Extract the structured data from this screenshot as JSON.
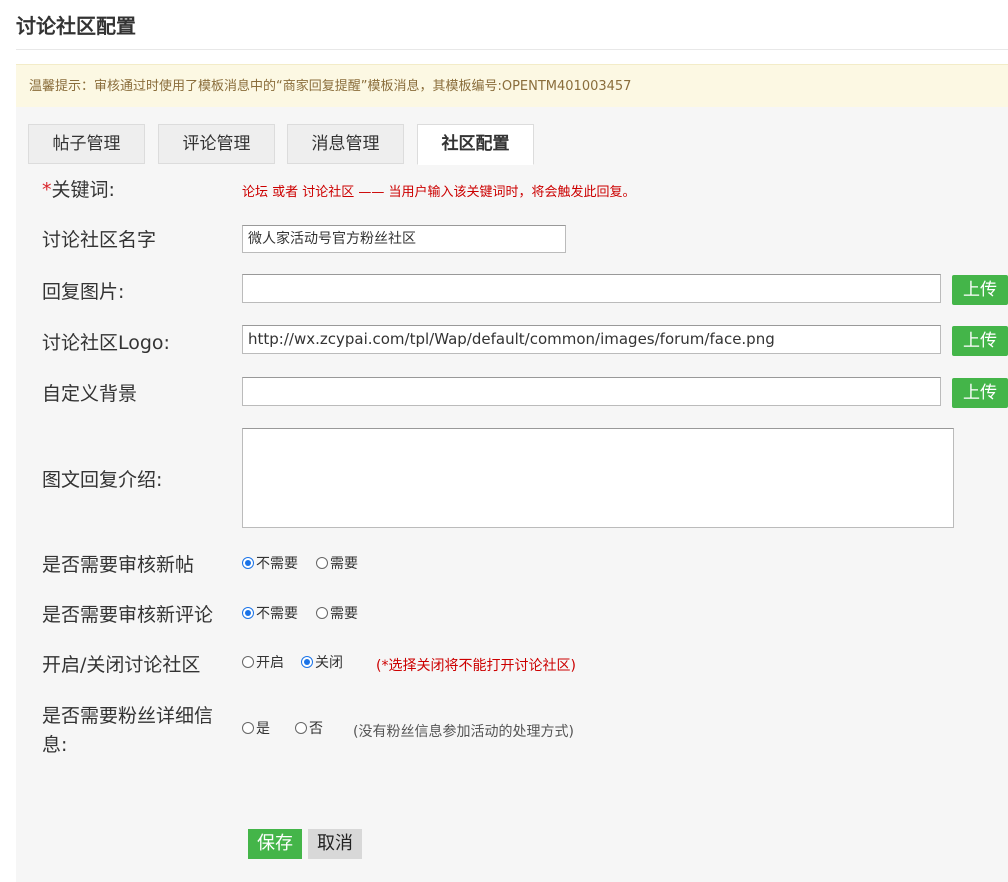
{
  "page_title": "讨论社区配置",
  "notice": "温馨提示：审核通过时使用了模板消息中的“商家回复提醒”模板消息，其模板编号:OPENTM401003457",
  "tabs": [
    {
      "label": "帖子管理",
      "active": false
    },
    {
      "label": "评论管理",
      "active": false
    },
    {
      "label": "消息管理",
      "active": false
    },
    {
      "label": "社区配置",
      "active": true
    }
  ],
  "form": {
    "keyword": {
      "required_mark": "*",
      "label": "关键词:",
      "hint": "论坛 或者 讨论社区 —— 当用户输入该关键词时，将会触发此回复。"
    },
    "community_name": {
      "label": "讨论社区名字",
      "value": "微人家活动号官方粉丝社区"
    },
    "reply_image": {
      "label": "回复图片:",
      "value": "",
      "upload_label": "上传"
    },
    "logo": {
      "label": "讨论社区Logo:",
      "value": "http://wx.zcypai.com/tpl/Wap/default/common/images/forum/face.png",
      "upload_label": "上传"
    },
    "background": {
      "label": "自定义背景",
      "value": "",
      "upload_label": "上传"
    },
    "intro": {
      "label": "图文回复介绍:",
      "value": ""
    },
    "review_posts": {
      "label": "是否需要审核新帖",
      "options": [
        "不需要",
        "需要"
      ],
      "selected": "不需要"
    },
    "review_comments": {
      "label": "是否需要审核新评论",
      "options": [
        "不需要",
        "需要"
      ],
      "selected": "不需要"
    },
    "toggle_community": {
      "label": "开启/关闭讨论社区",
      "options": [
        "开启",
        "关闭"
      ],
      "selected": "关闭",
      "hint": "(*选择关闭将不能打开讨论社区)"
    },
    "fan_details": {
      "label_line1": "是否需要粉丝详细信",
      "label_line2": "息:",
      "options": [
        "是",
        "否"
      ],
      "selected": "",
      "hint": "(没有粉丝信息参加活动的处理方式)"
    }
  },
  "actions": {
    "save_label": "保存",
    "cancel_label": "取消"
  },
  "colors": {
    "primary_green": "#44b549",
    "notice_bg": "#fcf8e3",
    "notice_text": "#8a6d3b",
    "hint_red": "#cc0000",
    "radio_checked": "#1a73e8"
  }
}
